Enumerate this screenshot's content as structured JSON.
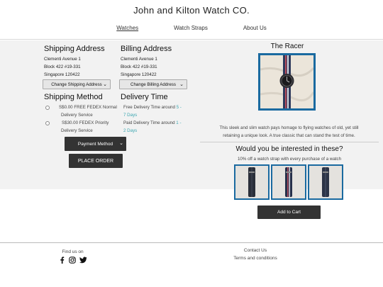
{
  "header": {
    "brand": "John and Kilton Watch CO.",
    "nav": [
      "Watches",
      "Watch Straps",
      "About Us"
    ]
  },
  "shipping": {
    "title": "Shipping Address",
    "lines": [
      "Clementi Avenue 1",
      "Block 422 #19-331",
      "Singapore 120422"
    ],
    "select_label": "Change Shipping Address"
  },
  "billing": {
    "title": "Billing Address",
    "lines": [
      "Clementi Avenue 1",
      "Block 422 #19-331",
      "Singapore 120422"
    ],
    "select_label": "Change Billing Address"
  },
  "shipping_method": {
    "title": "Shipping Method",
    "options": [
      {
        "line1": "S$0.00 FREE FEDEX Normal",
        "line2": "Delivery Service"
      },
      {
        "line1": "S$30.00 FEDEX Priority",
        "line2": "Delivery Service"
      }
    ]
  },
  "delivery": {
    "title": "Delivery Time",
    "items": [
      {
        "text": "Free Delivery Time around ",
        "days_a": "5 -",
        "days_b": "7 Days"
      },
      {
        "text": "Paid Delivery Time around ",
        "days_a": "1 -",
        "days_b": "2 Days"
      }
    ]
  },
  "payment_method_label": "Payment Method",
  "place_order_label": "PLACE ORDER",
  "product": {
    "name": "The Racer",
    "desc_lines": [
      "This sleek and slim watch pays homage to flying watches of old, yet still",
      "retaining a unique look. A true classic that can stand the test of time."
    ]
  },
  "upsell": {
    "title": "Would you be interested in these?",
    "subtitle": "10% off a watch strap with every purchase of a watch",
    "add_to_cart_label": "Add to Cart"
  },
  "footer": {
    "find_us": "Find us on",
    "contact": "Contact Us",
    "terms": "Terms and conditions",
    "social_icons": [
      "facebook-icon",
      "instagram-icon",
      "twitter-icon"
    ]
  },
  "colors": {
    "accent": "#1a6aa0",
    "teal_text": "#3aa6b0",
    "dark_button": "#333333",
    "panel_bg": "#f2f2f2"
  }
}
